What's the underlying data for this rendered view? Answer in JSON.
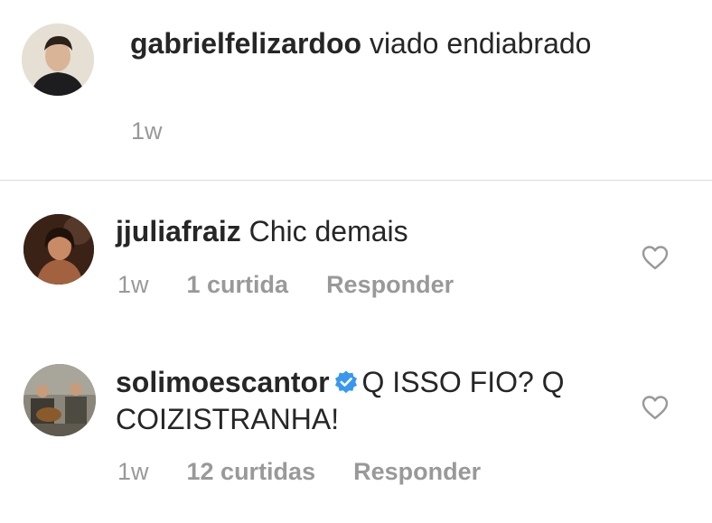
{
  "comments": [
    {
      "username": "gabrielfelizardoo",
      "text": "viado endiabrado",
      "time": "1w"
    },
    {
      "username": "jjuliafraiz",
      "text": "Chic demais",
      "time": "1w",
      "likes": "1 curtida",
      "reply": "Responder"
    },
    {
      "username": "solimoescantor",
      "verified": true,
      "text": "Q ISSO FIO? Q COIZISTRANHA!",
      "time": "1w",
      "likes": "12 curtidas",
      "reply": "Responder"
    }
  ],
  "icons": {
    "like": "heart-outline-icon",
    "verified": "verified-badge-icon"
  },
  "colors": {
    "text": "#262626",
    "meta": "#999999",
    "divider": "#dbdbdb",
    "verified": "#3897f0"
  }
}
